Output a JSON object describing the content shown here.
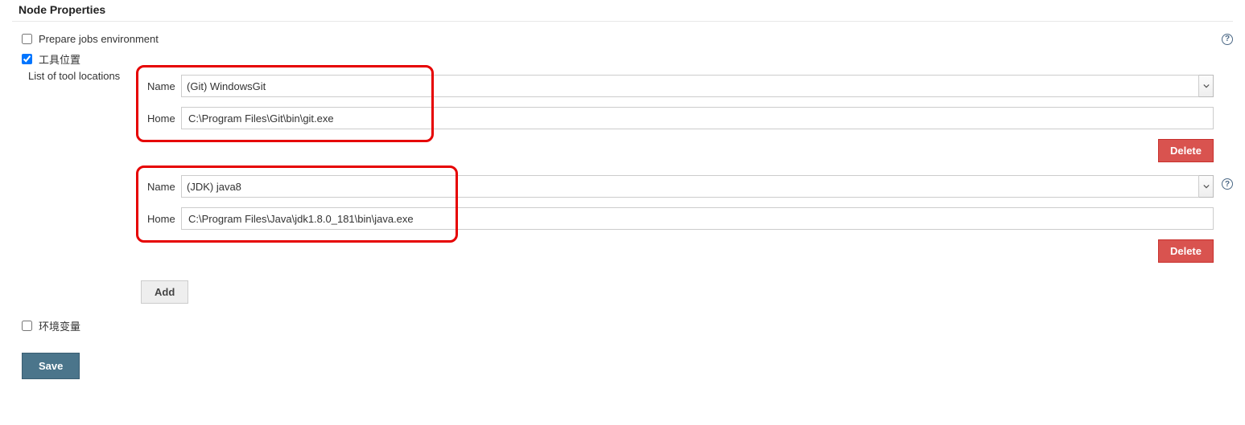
{
  "section_title": "Node Properties",
  "prepare_jobs": {
    "label": "Prepare jobs environment",
    "checked": false
  },
  "tool_location_toggle": {
    "label": "工具位置",
    "checked": true
  },
  "list_label": "List of tool locations",
  "env_vars": {
    "label": "环境变量",
    "checked": false
  },
  "field_labels": {
    "name": "Name",
    "home": "Home"
  },
  "tools": [
    {
      "name": "(Git) WindowsGit",
      "home": "C:\\Program Files\\Git\\bin\\git.exe"
    },
    {
      "name": "(JDK) java8",
      "home": "C:\\Program Files\\Java\\jdk1.8.0_181\\bin\\java.exe"
    }
  ],
  "buttons": {
    "delete": "Delete",
    "add": "Add",
    "save": "Save"
  },
  "help_glyph": "?"
}
